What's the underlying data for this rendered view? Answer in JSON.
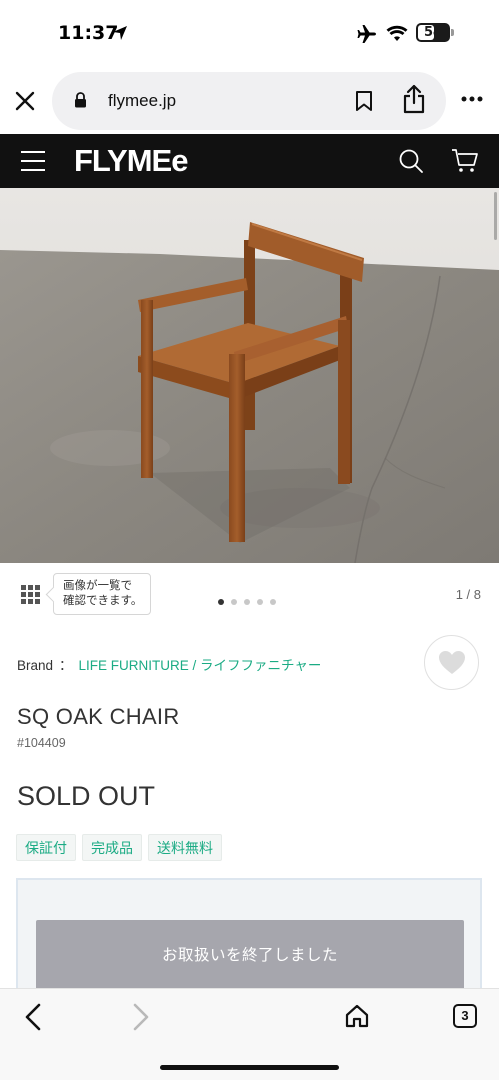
{
  "status_bar": {
    "time": "11:37",
    "battery": "54",
    "battery_level": 0.54
  },
  "browser": {
    "url": "flymee.jp",
    "open_tabs": "3"
  },
  "site": {
    "logo": "FLYMEe"
  },
  "gallery": {
    "tooltip_line1": "画像が一覧で",
    "tooltip_line2": "確認できます。",
    "counter": "1 / 8",
    "total_images": 8,
    "visible_dots": 5,
    "active_dot": 0
  },
  "product": {
    "brand_label": "Brand",
    "brand_separator": "：",
    "brand_name": "LIFE FURNITURE / ライフファニチャー",
    "title": "SQ OAK CHAIR",
    "code": "#104409",
    "status": "SOLD OUT",
    "tags": [
      "保証付",
      "完成品",
      "送料無料"
    ],
    "ended_message": "お取扱いを終了しました"
  },
  "colors": {
    "accent": "#1bab84",
    "header_bg": "#111111",
    "disabled_button": "#a6a6ad"
  },
  "icons": {
    "close": "close-icon",
    "lock": "lock-icon",
    "bookmark": "bookmark-icon",
    "share": "share-icon",
    "more": "more-icon",
    "menu": "hamburger-icon",
    "search": "search-icon",
    "cart": "cart-icon",
    "grid": "grid-icon",
    "favorite": "heart-icon",
    "back": "chevron-left-icon",
    "forward": "chevron-right-icon",
    "home": "home-icon"
  }
}
